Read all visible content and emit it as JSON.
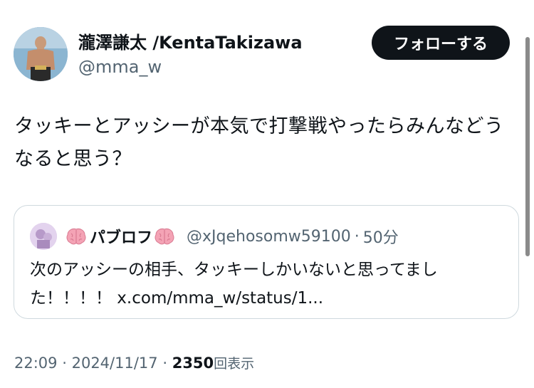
{
  "author": {
    "display_name": "瀧澤謙太 /KentaTakizawa",
    "handle": "@mma_w"
  },
  "follow_button": {
    "label": "フォローする"
  },
  "tweet": {
    "text": "タッキーとアッシーが本気で打撃戦やったらみんなどうなると思う？"
  },
  "quote": {
    "name": "パブロフ",
    "handle": "@xJqehosomw59100",
    "separator": "·",
    "time": "50分",
    "text": "次のアッシーの相手、タッキーしかいないと思ってました！！！！ x.com/mma_w/status/1..."
  },
  "meta": {
    "time": "22:09",
    "sep1": "·",
    "date": "2024/11/17",
    "sep2": "·",
    "views_count": "2350",
    "views_label": "回表示"
  },
  "icons": {
    "brain": "brain-icon",
    "avatar": "avatar",
    "quote_avatar": "quote-avatar"
  },
  "colors": {
    "text_primary": "#0f1419",
    "text_secondary": "#536471",
    "border": "#cfd9de",
    "follow_button_bg": "#0f1419"
  }
}
